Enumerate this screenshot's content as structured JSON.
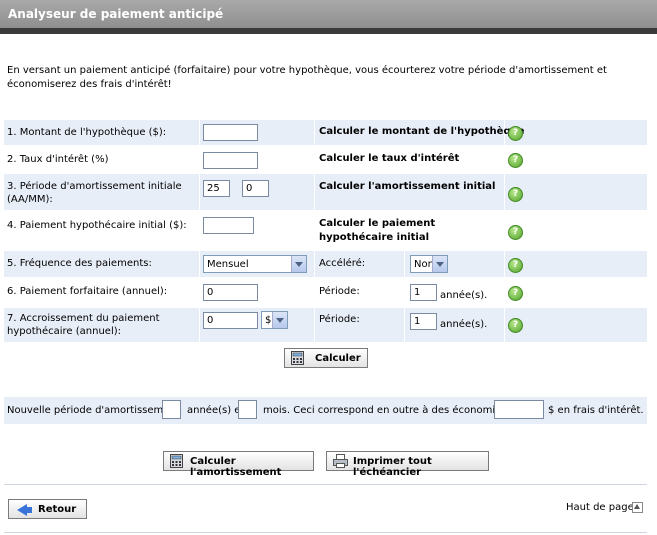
{
  "header": {
    "title": "Analyseur de paiement anticipé"
  },
  "intro": "En versant un paiement anticipé (forfaitaire) pour votre hypothèque, vous écourterez votre période d'amortissement et économiserez des frais d'intérêt!",
  "rows": [
    {
      "label": "1. Montant de l'hypothèque ($):",
      "value": "",
      "calc": "Calculer le montant de l'hypothèque"
    },
    {
      "label": "2. Taux d'intérêt (%)",
      "value": "",
      "calc": "Calculer le taux d'intérêt"
    },
    {
      "label": "3. Période d'amortissement initiale (AA/MM):",
      "value_years": "25",
      "value_months": "0",
      "calc": "Calculer l'amortissement initial"
    },
    {
      "label": "4. Paiement hypothécaire initial ($):",
      "value": "",
      "calc": "Calculer le paiement hypothécaire initial"
    },
    {
      "label": "5. Fréquence des paiements:",
      "value": "Mensuel",
      "extra_label": "Accéléré:",
      "extra_value": "Non"
    },
    {
      "label": "6. Paiement forfaitaire (annuel):",
      "value": "0",
      "extra_label": "Période:",
      "extra_value": "1",
      "unit": "année(s)."
    },
    {
      "label": "7. Accroissement du paiement hypothécaire (annuel):",
      "value": "0",
      "type_value": "$",
      "extra_label": "Période:",
      "extra_value": "1",
      "unit": "année(s)."
    }
  ],
  "buttons": {
    "calculate": "Calculer",
    "calc_amortization": "Calculer l'amortissement",
    "print_schedule": "Imprimer tout l'échéancier",
    "back": "Retour"
  },
  "result": {
    "prefix": "Nouvelle période d'amortissement",
    "years_unit": "année(s) et",
    "months_unit": "mois. Ceci correspond en outre à des économies de",
    "suffix": "$ en frais d'intérêt."
  },
  "footer": {
    "top_link": "Haut de page"
  },
  "icons": {
    "help": "help-icon"
  },
  "colors": {
    "header_bg": "#9a9a9a",
    "row_shade": "#e8eef8",
    "help_green": "#4fa02a"
  }
}
